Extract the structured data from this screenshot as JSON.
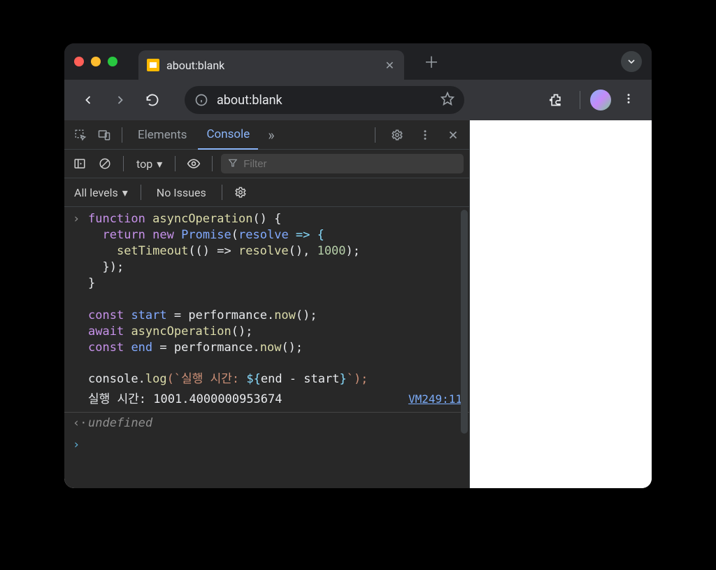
{
  "tab": {
    "title": "about:blank"
  },
  "address": {
    "url_text": "about:blank"
  },
  "devtools": {
    "tabs": {
      "elements": "Elements",
      "console": "Console"
    },
    "context": "top",
    "filter_placeholder": "Filter",
    "levels": "All levels",
    "issues": "No Issues"
  },
  "console": {
    "input_tokens": {
      "l1_kw_function": "function",
      "l1_fn": "asyncOperation",
      "l1_rest": "() {",
      "l2_kw_return": "return",
      "l2_kw_new": "new",
      "l2_promise": "Promise",
      "l2_resolve": "resolve",
      "l2_arrow": " => {",
      "l3_settimeout": "setTimeout",
      "l3_mid": "(() => ",
      "l3_resolve": "resolve",
      "l3_after": "(), ",
      "l3_num": "1000",
      "l3_end": ");",
      "l4": "});",
      "l5": "}",
      "l7_const": "const",
      "l7_start": "start",
      "l7_eq": " = ",
      "l7_perf": "performance",
      "l7_dot": ".",
      "l7_now": "now",
      "l7_end": "();",
      "l8_await": "await",
      "l8_fn": "asyncOperation",
      "l8_end": "();",
      "l9_const": "const",
      "l9_end_id": "end",
      "l9_eq": " = ",
      "l9_perf": "performance",
      "l9_now": "now",
      "l9_end": "();",
      "l11_console": "console",
      "l11_log": "log",
      "l11_tick_open": "(`",
      "l11_str_prefix": "실행 시간: ",
      "l11_interp_open": "${",
      "l11_expr": "end - start",
      "l11_interp_close": "}",
      "l11_tick_close": "`);"
    },
    "log_output": "실행 시간: 1001.4000000953674",
    "log_source": "VM249:11",
    "return_value": "undefined"
  }
}
